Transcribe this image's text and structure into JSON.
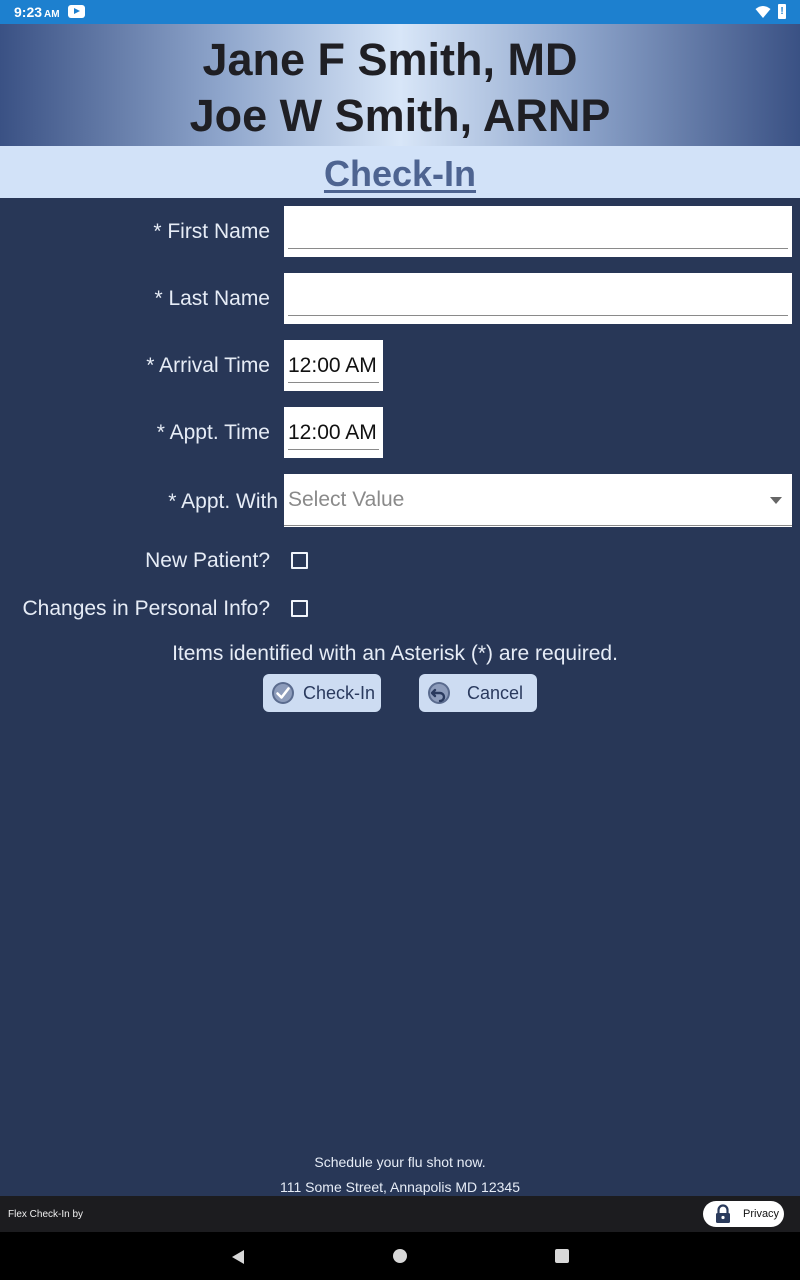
{
  "status_bar": {
    "time": "9:23",
    "ampm": "AM"
  },
  "header": {
    "line1": "Jane F Smith, MD",
    "line2": "Joe W Smith, ARNP"
  },
  "page_title": "Check-In",
  "form": {
    "first_name": {
      "label": "*  First Name",
      "value": ""
    },
    "last_name": {
      "label": "*  Last Name",
      "value": ""
    },
    "arrival_time": {
      "label": "*  Arrival Time",
      "value": "12:00 AM"
    },
    "appt_time": {
      "label": "*  Appt. Time",
      "value": "12:00 AM"
    },
    "appt_with": {
      "label": "*  Appt. With",
      "placeholder": "Select Value"
    },
    "new_patient": {
      "label": "New Patient?",
      "checked": false
    },
    "changes_info": {
      "label": "Changes in Personal Info?",
      "checked": false
    },
    "required_note": "Items identified with an Asterisk (*) are required."
  },
  "buttons": {
    "checkin": "Check-In",
    "cancel": "Cancel"
  },
  "footer": {
    "promo": "Schedule your flu shot now.",
    "address": "111 Some Street, Annapolis MD 12345",
    "brand": "Flex Check-In by",
    "privacy": "Privacy"
  },
  "icons": {
    "status": [
      "youtube-icon",
      "wifi-icon",
      "battery-alert-icon"
    ],
    "checkin_button": "checkmark-circle-icon",
    "cancel_button": "undo-arrow-icon",
    "privacy_button": "padlock-icon",
    "nav": [
      "back-icon",
      "home-icon",
      "recents-icon"
    ]
  },
  "colors": {
    "status_bar": "#1d80cf",
    "background": "#283757",
    "title_bar": "#d2e2f8",
    "title_text": "#4e6491",
    "button": "#cddcf2"
  }
}
